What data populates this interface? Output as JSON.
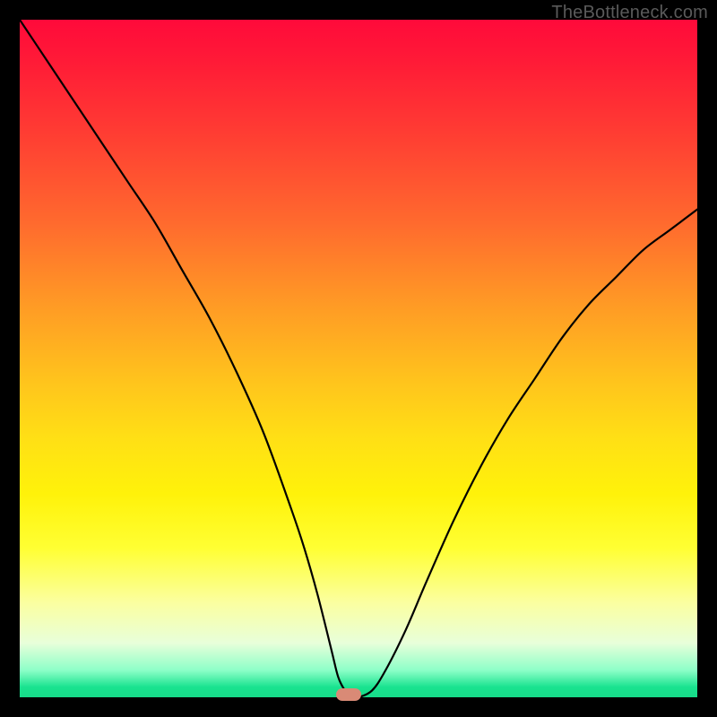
{
  "watermark": "TheBottleneck.com",
  "chart_data": {
    "type": "line",
    "title": "",
    "xlabel": "",
    "ylabel": "",
    "xlim": [
      0,
      100
    ],
    "ylim": [
      0,
      100
    ],
    "grid": false,
    "legend": false,
    "background_gradient": {
      "direction": "vertical",
      "stops": [
        {
          "pos": 0,
          "color": "#ff0a3a"
        },
        {
          "pos": 50,
          "color": "#ffd020"
        },
        {
          "pos": 80,
          "color": "#ffff40"
        },
        {
          "pos": 97,
          "color": "#90ffc8"
        },
        {
          "pos": 100,
          "color": "#17db89"
        }
      ]
    },
    "series": [
      {
        "name": "bottleneck-curve",
        "color": "#000000",
        "x": [
          0,
          4,
          8,
          12,
          16,
          20,
          24,
          28,
          32,
          36,
          40,
          42,
          44,
          46,
          47,
          48,
          49,
          50,
          52,
          54,
          57,
          60,
          64,
          68,
          72,
          76,
          80,
          84,
          88,
          92,
          96,
          100
        ],
        "y": [
          100,
          94,
          88,
          82,
          76,
          70,
          63,
          56,
          48,
          39,
          28,
          22,
          15,
          7,
          3,
          1,
          0,
          0,
          1,
          4,
          10,
          17,
          26,
          34,
          41,
          47,
          53,
          58,
          62,
          66,
          69,
          72
        ]
      }
    ],
    "marker": {
      "name": "optimal-point",
      "x": 48.5,
      "y": 0,
      "color": "#d98a76",
      "shape": "pill"
    }
  }
}
